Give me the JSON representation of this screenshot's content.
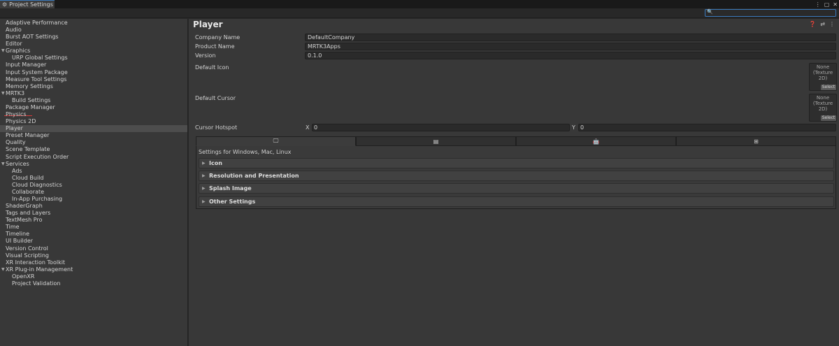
{
  "window": {
    "tab_title": "Project Settings",
    "controls": [
      "⋮",
      "▢",
      "✕"
    ]
  },
  "search": {
    "placeholder": "",
    "value": ""
  },
  "sidebar": {
    "items": [
      {
        "label": "Adaptive Performance",
        "indent": 0
      },
      {
        "label": "Audio",
        "indent": 0
      },
      {
        "label": "Burst AOT Settings",
        "indent": 0
      },
      {
        "label": "Editor",
        "indent": 0
      },
      {
        "label": "Graphics",
        "indent": 0,
        "expanded": true
      },
      {
        "label": "URP Global Settings",
        "indent": 1
      },
      {
        "label": "Input Manager",
        "indent": 0
      },
      {
        "label": "Input System Package",
        "indent": 0
      },
      {
        "label": "Measure Tool Settings",
        "indent": 0
      },
      {
        "label": "Memory Settings",
        "indent": 0
      },
      {
        "label": "MRTK3",
        "indent": 0,
        "expanded": true
      },
      {
        "label": "Build Settings",
        "indent": 1
      },
      {
        "label": "Package Manager",
        "indent": 0
      },
      {
        "label": "Physics",
        "indent": 0
      },
      {
        "label": "Physics 2D",
        "indent": 0
      },
      {
        "label": "Player",
        "indent": 0,
        "selected": true
      },
      {
        "label": "Preset Manager",
        "indent": 0
      },
      {
        "label": "Quality",
        "indent": 0
      },
      {
        "label": "Scene Template",
        "indent": 0
      },
      {
        "label": "Script Execution Order",
        "indent": 0
      },
      {
        "label": "Services",
        "indent": 0,
        "expanded": true
      },
      {
        "label": "Ads",
        "indent": 1
      },
      {
        "label": "Cloud Build",
        "indent": 1
      },
      {
        "label": "Cloud Diagnostics",
        "indent": 1
      },
      {
        "label": "Collaborate",
        "indent": 1
      },
      {
        "label": "In-App Purchasing",
        "indent": 1
      },
      {
        "label": "ShaderGraph",
        "indent": 0
      },
      {
        "label": "Tags and Layers",
        "indent": 0
      },
      {
        "label": "TextMesh Pro",
        "indent": 0
      },
      {
        "label": "Time",
        "indent": 0
      },
      {
        "label": "Timeline",
        "indent": 0
      },
      {
        "label": "UI Builder",
        "indent": 0
      },
      {
        "label": "Version Control",
        "indent": 0
      },
      {
        "label": "Visual Scripting",
        "indent": 0
      },
      {
        "label": "XR Interaction Toolkit",
        "indent": 0
      },
      {
        "label": "XR Plug-in Management",
        "indent": 0,
        "expanded": true
      },
      {
        "label": "OpenXR",
        "indent": 1
      },
      {
        "label": "Project Validation",
        "indent": 1
      }
    ]
  },
  "main": {
    "title": "Player",
    "header_icons": [
      "help-icon",
      "preset-icon",
      "more-icon"
    ],
    "company_name": {
      "label": "Company Name",
      "value": "DefaultCompany"
    },
    "product_name": {
      "label": "Product Name",
      "value": "MRTK3Apps"
    },
    "version": {
      "label": "Version",
      "value": "0.1.0"
    },
    "default_icon": {
      "label": "Default Icon",
      "slot_line1": "None",
      "slot_line2": "(Texture 2D)",
      "select": "Select"
    },
    "default_cursor": {
      "label": "Default Cursor",
      "slot_line1": "None",
      "slot_line2": "(Texture 2D)",
      "select": "Select"
    },
    "cursor_hotspot": {
      "label": "Cursor Hotspot",
      "x_label": "X",
      "x_value": "0",
      "y_label": "Y",
      "y_value": "0"
    },
    "platform_tabs": [
      {
        "icon": "monitor-icon",
        "glyph": "🖵",
        "active": true
      },
      {
        "icon": "server-icon",
        "glyph": "▤"
      },
      {
        "icon": "android-icon",
        "glyph": "🤖"
      },
      {
        "icon": "windows-icon",
        "glyph": "⊞"
      }
    ],
    "settings_for": "Settings for Windows, Mac, Linux",
    "sections": [
      {
        "label": "Icon"
      },
      {
        "label": "Resolution and Presentation"
      },
      {
        "label": "Splash Image"
      },
      {
        "label": "Other Settings"
      }
    ]
  }
}
